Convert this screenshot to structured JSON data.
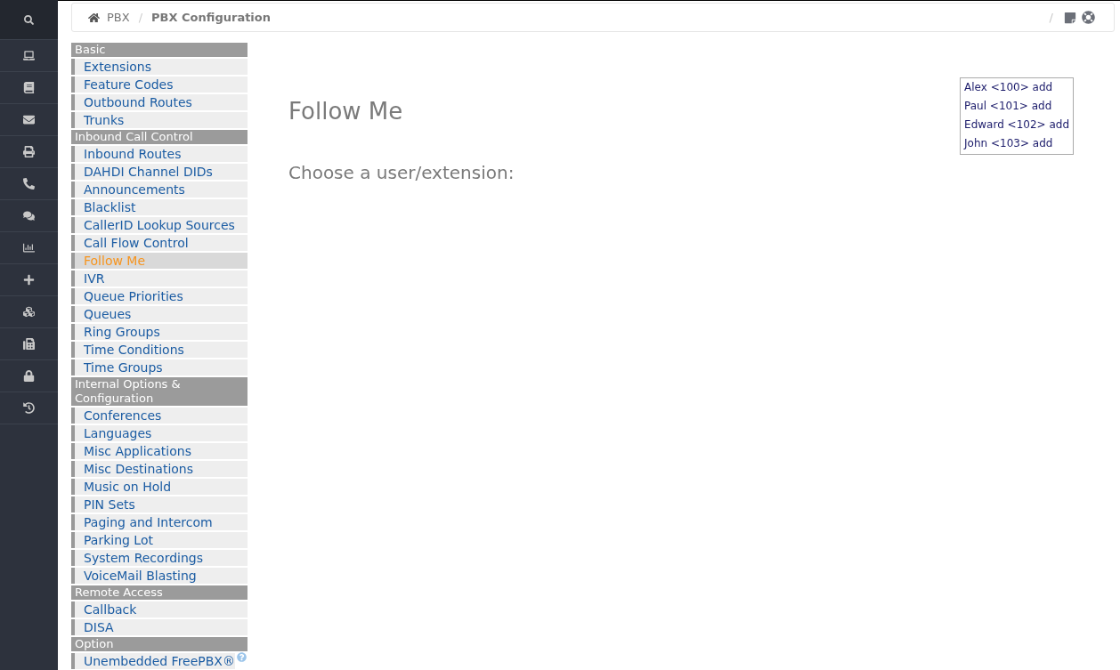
{
  "breadcrumb": {
    "items": [
      {
        "label": "PBX",
        "current": false
      },
      {
        "label": "PBX Configuration",
        "current": true
      }
    ],
    "separator": "/",
    "tools_separator": "/"
  },
  "menu": [
    {
      "heading": "Basic",
      "items": [
        {
          "label": "Extensions",
          "selected": false,
          "kind": "page"
        },
        {
          "label": "Feature Codes",
          "selected": false,
          "kind": "page"
        },
        {
          "label": "Outbound Routes",
          "selected": false,
          "kind": "page"
        },
        {
          "label": "Trunks",
          "selected": false,
          "kind": "page"
        }
      ]
    },
    {
      "heading": "Inbound Call Control",
      "items": [
        {
          "label": "Inbound Routes",
          "selected": false,
          "kind": "page"
        },
        {
          "label": "DAHDI Channel DIDs",
          "selected": false,
          "kind": "page"
        },
        {
          "label": "Announcements",
          "selected": false,
          "kind": "page"
        },
        {
          "label": "Blacklist",
          "selected": false,
          "kind": "page"
        },
        {
          "label": "CallerID Lookup Sources",
          "selected": false,
          "kind": "page"
        },
        {
          "label": "Call Flow Control",
          "selected": false,
          "kind": "page"
        },
        {
          "label": "Follow Me",
          "selected": true,
          "kind": "page"
        },
        {
          "label": "IVR",
          "selected": false,
          "kind": "page"
        },
        {
          "label": "Queue Priorities",
          "selected": false,
          "kind": "page"
        },
        {
          "label": "Queues",
          "selected": false,
          "kind": "page"
        },
        {
          "label": "Ring Groups",
          "selected": false,
          "kind": "page"
        },
        {
          "label": "Time Conditions",
          "selected": false,
          "kind": "page"
        },
        {
          "label": "Time Groups",
          "selected": false,
          "kind": "page"
        }
      ]
    },
    {
      "heading": "Internal Options & Configuration",
      "items": [
        {
          "label": "Conferences",
          "selected": false,
          "kind": "page"
        },
        {
          "label": "Languages",
          "selected": false,
          "kind": "page"
        },
        {
          "label": "Misc Applications",
          "selected": false,
          "kind": "page"
        },
        {
          "label": "Misc Destinations",
          "selected": false,
          "kind": "page"
        },
        {
          "label": "Music on Hold",
          "selected": false,
          "kind": "page"
        },
        {
          "label": "PIN Sets",
          "selected": false,
          "kind": "page"
        },
        {
          "label": "Paging and Intercom",
          "selected": false,
          "kind": "page"
        },
        {
          "label": "Parking Lot",
          "selected": false,
          "kind": "page"
        },
        {
          "label": "System Recordings",
          "selected": false,
          "kind": "page"
        },
        {
          "label": "VoiceMail Blasting",
          "selected": false,
          "kind": "page"
        }
      ]
    },
    {
      "heading": "Remote Access",
      "items": [
        {
          "label": "Callback",
          "selected": false,
          "kind": "page"
        },
        {
          "label": "DISA",
          "selected": false,
          "kind": "page"
        }
      ]
    },
    {
      "heading": "Option",
      "items": [
        {
          "label": "Unembedded FreePBX®",
          "selected": false,
          "kind": "help-page"
        }
      ]
    }
  ],
  "page": {
    "title": "Follow Me",
    "prompt": "Choose a user/extension:"
  },
  "user_list": [
    {
      "label": "Alex <100> add"
    },
    {
      "label": "Paul <101> add"
    },
    {
      "label": "Edward <102> add"
    },
    {
      "label": "John <103> add"
    }
  ]
}
